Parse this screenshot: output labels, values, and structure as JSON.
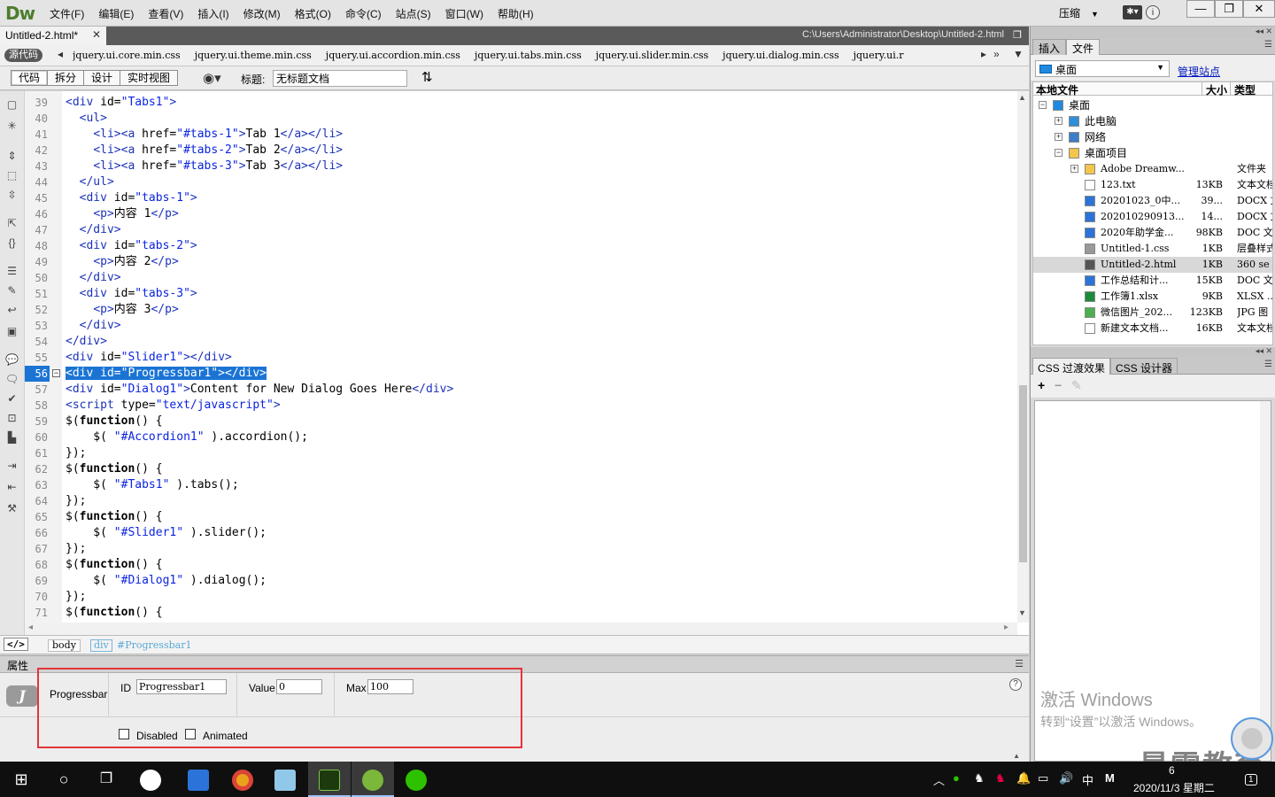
{
  "app": {
    "logo": "Dw",
    "menus": [
      "文件(F)",
      "编辑(E)",
      "查看(V)",
      "插入(I)",
      "修改(M)",
      "格式(O)",
      "命令(C)",
      "站点(S)",
      "窗口(W)",
      "帮助(H)"
    ],
    "compress_label": "压缩",
    "window_buttons": [
      "—",
      "❐",
      "✕"
    ]
  },
  "document": {
    "tab_title": "Untitled-2.html*",
    "path": "C:\\Users\\Administrator\\Desktop\\Untitled-2.html",
    "source_code_label": "源代码",
    "related_files": [
      "jquery.ui.core.min.css",
      "jquery.ui.theme.min.css",
      "jquery.ui.accordion.min.css",
      "jquery.ui.tabs.min.css",
      "jquery.ui.slider.min.css",
      "jquery.ui.dialog.min.css",
      "jquery.ui.r"
    ],
    "view_buttons": [
      "代码",
      "拆分",
      "设计",
      "实时视图"
    ],
    "title_label": "标题:",
    "title_value": "无标题文档"
  },
  "code": {
    "current_line": 56,
    "lines": [
      {
        "n": 39,
        "t": "<div id=\"Tabs1\">"
      },
      {
        "n": 40,
        "t": "  <ul>"
      },
      {
        "n": 41,
        "t": "    <li><a href=\"#tabs-1\">Tab 1</a></li>"
      },
      {
        "n": 42,
        "t": "    <li><a href=\"#tabs-2\">Tab 2</a></li>"
      },
      {
        "n": 43,
        "t": "    <li><a href=\"#tabs-3\">Tab 3</a></li>"
      },
      {
        "n": 44,
        "t": "  </ul>"
      },
      {
        "n": 45,
        "t": "  <div id=\"tabs-1\">"
      },
      {
        "n": 46,
        "t": "    <p>内容 1</p>"
      },
      {
        "n": 47,
        "t": "  </div>"
      },
      {
        "n": 48,
        "t": "  <div id=\"tabs-2\">"
      },
      {
        "n": 49,
        "t": "    <p>内容 2</p>"
      },
      {
        "n": 50,
        "t": "  </div>"
      },
      {
        "n": 51,
        "t": "  <div id=\"tabs-3\">"
      },
      {
        "n": 52,
        "t": "    <p>内容 3</p>"
      },
      {
        "n": 53,
        "t": "  </div>"
      },
      {
        "n": 54,
        "t": "</div>"
      },
      {
        "n": 55,
        "t": "<div id=\"Slider1\"></div>"
      },
      {
        "n": 56,
        "t": "<div id=\"Progressbar1\"></div>"
      },
      {
        "n": 57,
        "t": "<div id=\"Dialog1\">Content for New Dialog Goes Here</div>"
      },
      {
        "n": 58,
        "t": "<script type=\"text/javascript\">"
      },
      {
        "n": 59,
        "t": "$(function() {"
      },
      {
        "n": 60,
        "t": "    $( \"#Accordion1\" ).accordion();"
      },
      {
        "n": 61,
        "t": "});"
      },
      {
        "n": 62,
        "t": "$(function() {"
      },
      {
        "n": 63,
        "t": "    $( \"#Tabs1\" ).tabs();"
      },
      {
        "n": 64,
        "t": "});"
      },
      {
        "n": 65,
        "t": "$(function() {"
      },
      {
        "n": 66,
        "t": "    $( \"#Slider1\" ).slider();"
      },
      {
        "n": 67,
        "t": "});"
      },
      {
        "n": 68,
        "t": "$(function() {"
      },
      {
        "n": 69,
        "t": "    $( \"#Dialog1\" ).dialog();"
      },
      {
        "n": 70,
        "t": "});"
      },
      {
        "n": 71,
        "t": "$(function() {"
      }
    ]
  },
  "tag_selector": {
    "code_icon": "</>",
    "body": "body",
    "div": "div",
    "id": "#Progressbar1"
  },
  "properties": {
    "header": "属性",
    "widget": "Progressbar",
    "id_label": "ID",
    "id_value": "Progressbar1",
    "value_label": "Value",
    "value_value": "0",
    "max_label": "Max",
    "max_value": "100",
    "disabled_label": "Disabled",
    "animated_label": "Animated",
    "help": "?"
  },
  "files_panel": {
    "tabs": [
      "插入",
      "文件"
    ],
    "location": "桌面",
    "manage_link": "管理站点",
    "col_local": "本地文件",
    "col_size": "大小",
    "col_type": "类型",
    "tree": [
      {
        "name": "桌面",
        "level": 0,
        "exp": "⊟",
        "icon": "desktop-icon"
      },
      {
        "name": "此电脑",
        "level": 1,
        "exp": "⊞",
        "icon": "computer-icon"
      },
      {
        "name": "网络",
        "level": 1,
        "exp": "⊞",
        "icon": "network-icon"
      },
      {
        "name": "桌面项目",
        "level": 1,
        "exp": "⊟",
        "icon": "folder-icon"
      },
      {
        "name": "Adobe Dreamw...",
        "level": 2,
        "exp": "⊞",
        "icon": "folder-icon",
        "size": "",
        "type": "文件夹"
      },
      {
        "name": "123.txt",
        "level": 2,
        "icon": "txt-file-icon",
        "size": "13KB",
        "type": "文本文档"
      },
      {
        "name": "20201023_0中...",
        "level": 2,
        "icon": "docx-file-icon",
        "size": "39...",
        "type": "DOCX 文"
      },
      {
        "name": "202010290913...",
        "level": 2,
        "icon": "docx-file-icon",
        "size": "14...",
        "type": "DOCX 文"
      },
      {
        "name": "2020年助学金...",
        "level": 2,
        "icon": "doc-file-icon",
        "size": "98KB",
        "type": "DOC 文档"
      },
      {
        "name": "Untitled-1.css",
        "level": 2,
        "icon": "css-file-icon",
        "size": "1KB",
        "type": "层叠样式"
      },
      {
        "name": "Untitled-2.html",
        "level": 2,
        "icon": "html-file-icon",
        "size": "1KB",
        "type": "360 se",
        "selected": true
      },
      {
        "name": "工作总结和计...",
        "level": 2,
        "icon": "doc-file-icon",
        "size": "15KB",
        "type": "DOC 文档"
      },
      {
        "name": "工作簿1.xlsx",
        "level": 2,
        "icon": "xlsx-file-icon",
        "size": "9KB",
        "type": "XLSX ..."
      },
      {
        "name": "微信图片_202...",
        "level": 2,
        "icon": "image-file-icon",
        "size": "123KB",
        "type": "JPG 图"
      },
      {
        "name": "新建文本文档...",
        "level": 2,
        "icon": "txt-file-icon",
        "size": "16KB",
        "type": "文本文档"
      }
    ]
  },
  "css_panel": {
    "tabs": [
      "CSS 过渡效果",
      "CSS 设计器"
    ],
    "tools": [
      "+",
      "−",
      "✎"
    ]
  },
  "overlay": {
    "activate_title": "激活 Windows",
    "activate_sub": "转到“设置”以激活 Windows。",
    "brand": "最需教育"
  },
  "taskbar": {
    "ime": "中",
    "clock_time": "6",
    "clock_date": "2020/11/3 星期二",
    "notif": "1"
  },
  "colors": {
    "selection": "#1b74d4",
    "tag": "#1c33b9",
    "highlight_border": "#e4353a",
    "dw_green": "#4d7e2f"
  }
}
